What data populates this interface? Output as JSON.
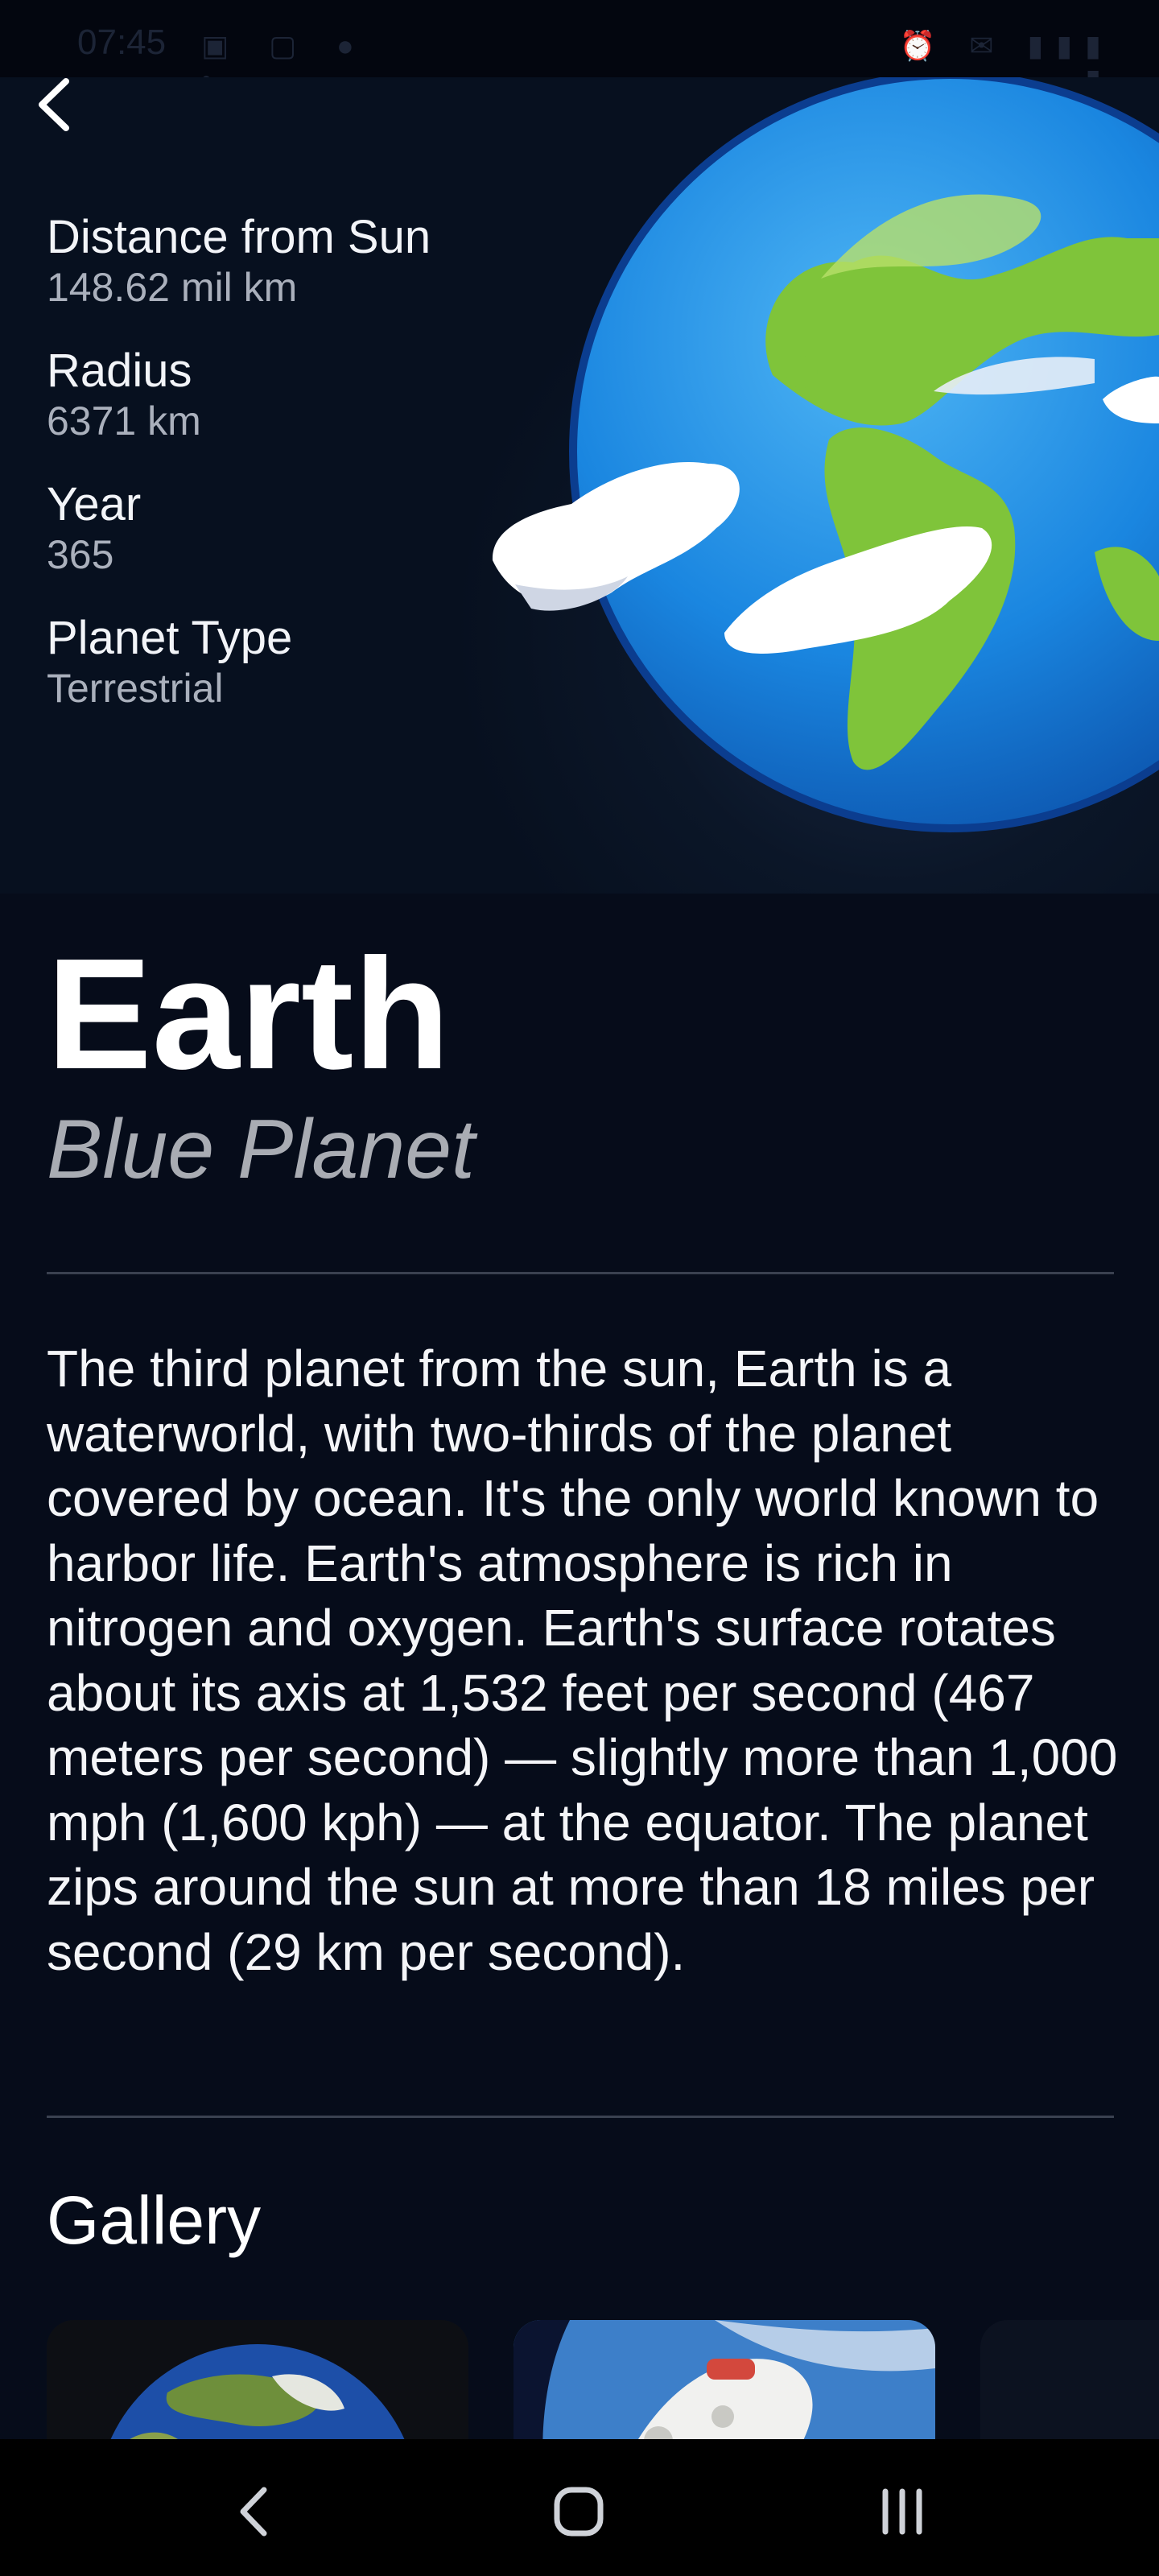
{
  "status_bar": {
    "time": "07:45",
    "left_icons": "▣ ▢ ● •",
    "right_icons": "⏰ ✉ ▮▮▮ ▮"
  },
  "planet": {
    "name": "Earth",
    "nickname": "Blue Planet",
    "stats": [
      {
        "label": "Distance from Sun",
        "value": "148.62 mil km"
      },
      {
        "label": "Radius",
        "value": "6371 km"
      },
      {
        "label": "Year",
        "value": "365"
      },
      {
        "label": "Planet Type",
        "value": "Terrestrial"
      }
    ],
    "description": "The third planet from the sun, Earth is a waterworld, with two-thirds of the planet covered by ocean. It's the only world known to harbor life. Earth's atmosphere is rich in nitrogen and oxygen. Earth's surface rotates about its axis at 1,532 feet per second (467 meters per second) — slightly more than 1,000 mph (1,600 kph) — at the equator. The planet zips around the sun at more than 18 miles per second (29 km per second)."
  },
  "gallery": {
    "title": "Gallery"
  },
  "icons": {
    "back": "chevron-left-icon",
    "nav_back": "nav-back-icon",
    "nav_home": "nav-home-icon",
    "nav_recents": "nav-recents-icon"
  },
  "colors": {
    "background": "#060c1a",
    "ocean": "#1a86e0",
    "land": "#7fc43a",
    "muted_text": "#aab0bc"
  }
}
